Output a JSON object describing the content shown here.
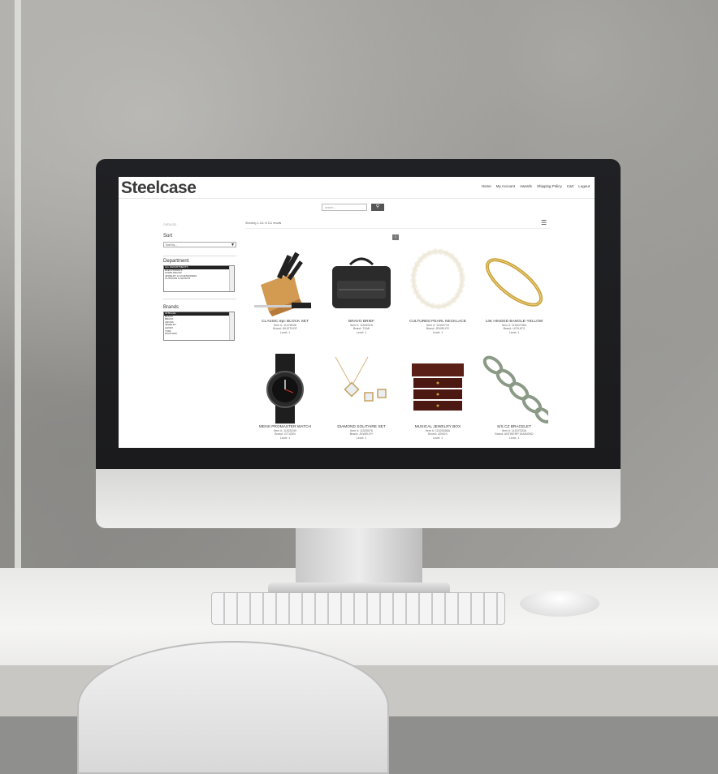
{
  "site": {
    "logo": "Steelcase"
  },
  "nav": [
    "Home",
    "My Account",
    "Awards",
    "Shipping Policy",
    "Cart",
    "Logout"
  ],
  "search": {
    "placeholder": "search..."
  },
  "catalog_label": "CATALOG",
  "results_text": "Showing 1-111 of 111 results",
  "pagination": {
    "current": "1"
  },
  "sidebar": {
    "sort_title": "Sort",
    "sort_value": "Sort by...",
    "department_title": "Department",
    "departments": [
      "ALL DEPARTMENTS",
      "ELECTRONICS",
      "HOME DECOR",
      "JEWELRY & ACCESSORIES",
      "OUTDOOR & SPORTS"
    ],
    "brands_title": "Brands",
    "brands": [
      "All Brands",
      "BLACK",
      "BRAVO",
      "CROSS",
      "JEWELRY",
      "LENOX",
      "TUMI",
      "WUSTHOF"
    ]
  },
  "products": [
    {
      "name": "CLASSIC 8pc BLOCK SET",
      "item": "Item #: 11478036",
      "brand": "Brand: WUSTHOF",
      "level": "Level: 1",
      "image": "knife-block"
    },
    {
      "name": "BRAVO BRIEF",
      "item": "Item #: 11500016",
      "brand": "Brand: TUMI",
      "level": "Level: 1",
      "image": "briefcase"
    },
    {
      "name": "CULTURED PEARL NECKLACE",
      "item": "Item #: 11500716",
      "brand": "Brand: JEWELRY",
      "level": "Level: 1",
      "image": "pearl-necklace"
    },
    {
      "name": "14K HINGED BANGLE-YELLOW",
      "item": "Item #: 11500736A",
      "brand": "Brand: LESLIE'S",
      "level": "Level: 1",
      "image": "bangle"
    },
    {
      "name": "MENS PROMASTER WATCH",
      "item": "Item #: 11525249",
      "brand": "Brand: CITIZEN",
      "level": "Level: 1",
      "image": "watch"
    },
    {
      "name": "DIAMOND SOLITAIRE SET",
      "item": "Item #: 11525076",
      "brand": "Brand: JEWELRY",
      "level": "Level: 1",
      "image": "diamond-set"
    },
    {
      "name": "MUSICAL JEWELRY BOX",
      "item": "Item #: 11525266A",
      "brand": "Brand: LENOX",
      "level": "Level: 1",
      "image": "jewelry-box"
    },
    {
      "name": "S/S CZ BRACELET",
      "item": "Item #: 11537020A",
      "brand": "Brand: ANTWERP DIAMOND",
      "level": "Level: 1",
      "image": "chain-bracelet"
    }
  ],
  "colors": {
    "logo": "#3a3a3a",
    "search_button": "#555555",
    "selected": "#222222"
  },
  "icons": {
    "search": "search-icon",
    "list_view": "list-view-icon",
    "sort": "chevron-down-icon"
  }
}
